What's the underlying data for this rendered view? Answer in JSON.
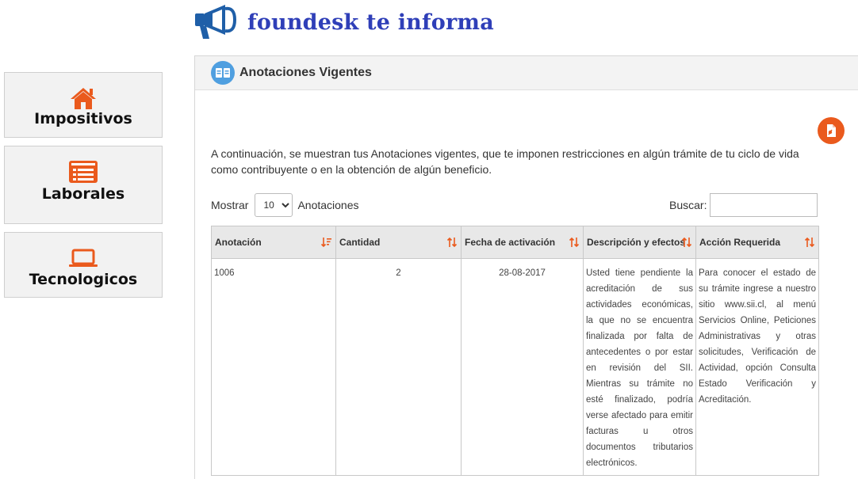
{
  "header": {
    "title": "foundesk te informa",
    "icon": "megaphone-icon"
  },
  "sidebar": {
    "items": [
      {
        "label": "Impositivos",
        "icon": "home-icon"
      },
      {
        "label": "Laborales",
        "icon": "list-icon"
      },
      {
        "label": "Tecnologicos",
        "icon": "laptop-icon"
      }
    ]
  },
  "panel": {
    "title": "Anotaciones Vigentes",
    "intro": "A continuación, se muestran tus Anotaciones vigentes, que te imponen restricciones en algún trámite de tu ciclo de vida como contribuyente o en la obtención de algún beneficio.",
    "show_label": "Mostrar",
    "show_value": "10",
    "show_suffix": "Anotaciones",
    "search_label": "Buscar:",
    "search_value": ""
  },
  "table": {
    "headers": [
      "Anotación",
      "Cantidad",
      "Fecha de activación",
      "Descripción y efectos",
      "Acción Requerida"
    ],
    "rows": [
      {
        "anotacion": "1006",
        "cantidad": "2",
        "fecha": "28-08-2017",
        "descripcion": "Usted tiene pendiente la acreditación de sus actividades económicas, la que no se encuentra finalizada por falta de antecedentes o por estar en revisión del SII. Mientras su trámite no esté finalizado, podría verse afectado para emitir facturas u otros documentos tributarios electrónicos.",
        "accion": "Para conocer el estado de su trámite ingrese a nuestro sitio www.sii.cl, al menú Servicios Online, Peticiones Administrativas y otras solicitudes, Verificación de Actividad, opción Consulta Estado Verificación y Acreditación."
      }
    ]
  },
  "colors": {
    "accent": "#ea5a1d",
    "brand": "#2f3fb8",
    "icon_blue": "#1f5fa8"
  }
}
